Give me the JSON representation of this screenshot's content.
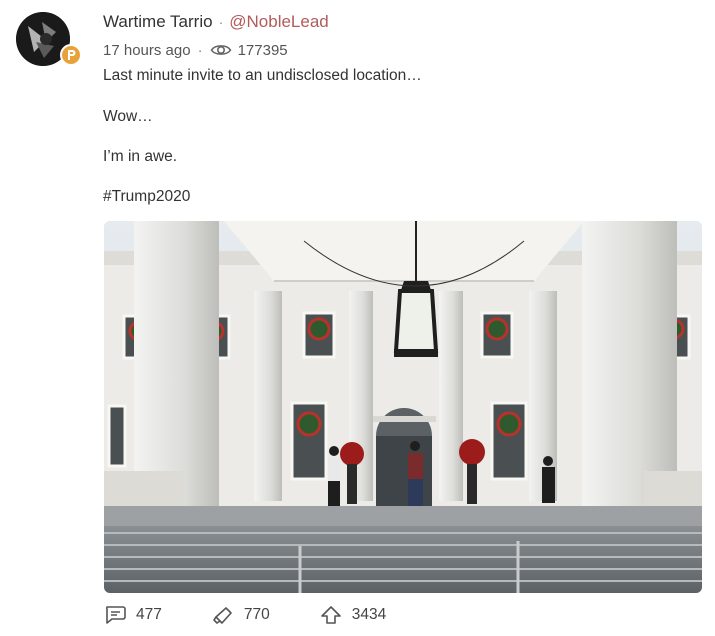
{
  "author": {
    "display_name": "Wartime Tarrio",
    "separator": "·",
    "handle": "@NobleLead"
  },
  "meta": {
    "timestamp": "17 hours ago",
    "separator": "·",
    "view_count": "177395"
  },
  "post_text": {
    "line1": "Last minute invite to an undisclosed location…",
    "line2": "Wow…",
    "line3": "I’m in awe.",
    "line4": "#Trump2020"
  },
  "actions": {
    "comments": "477",
    "echoes": "770",
    "upvotes": "3434"
  },
  "icons": {
    "views": "eye-icon",
    "comments": "comment-bubble-icon",
    "echoes": "megaphone-icon",
    "upvotes": "upvote-arrow-icon",
    "badge": "parler-badge-icon"
  },
  "colors": {
    "handle": "#b35a5a",
    "badge": "#e8a23a"
  }
}
